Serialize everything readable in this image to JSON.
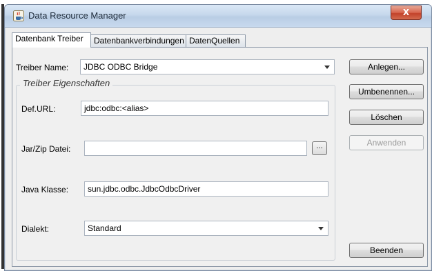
{
  "window": {
    "title": "Data Resource Manager",
    "close_symbol": "X"
  },
  "tabs": [
    {
      "label": "Datenbank Treiber",
      "active": true
    },
    {
      "label": "Datenbankverbindungen",
      "active": false
    },
    {
      "label": "DatenQuellen",
      "active": false
    }
  ],
  "form": {
    "treiber_name_label": "Treiber Name:",
    "treiber_name_value": "JDBC ODBC Bridge",
    "group_title": "Treiber Eigenschaften",
    "def_url_label": "Def.URL:",
    "def_url_value": "jdbc:odbc:<alias>",
    "jar_label": "Jar/Zip Datei:",
    "jar_value": "",
    "browse_label": "...",
    "java_klasse_label": "Java Klasse:",
    "java_klasse_value": "sun.jdbc.odbc.JdbcOdbcDriver",
    "dialekt_label": "Dialekt:",
    "dialekt_value": "Standard"
  },
  "buttons": {
    "anlegen": "Anlegen...",
    "umbenennen": "Umbenennen...",
    "loeschen": "Löschen",
    "anwenden": "Anwenden",
    "beenden": "Beenden"
  },
  "icons": {
    "app": "java-cup-icon",
    "dropdown": "chevron-down-icon",
    "close": "close-icon"
  }
}
